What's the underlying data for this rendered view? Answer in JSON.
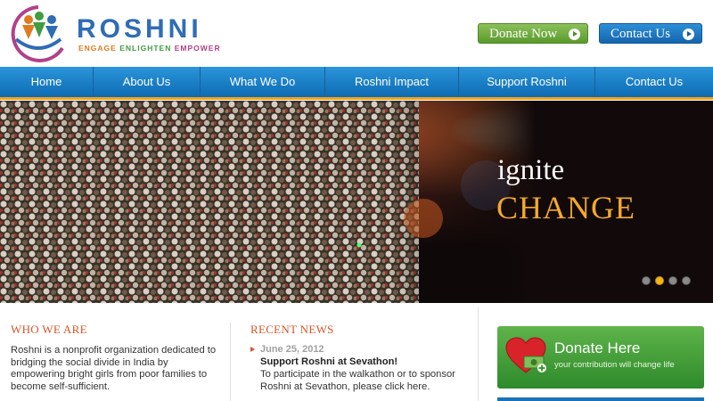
{
  "brand": {
    "name": "ROSHNI",
    "tagline": [
      "ENGAGE",
      "ENLIGHTEN",
      "EMPOWER"
    ]
  },
  "header_buttons": {
    "donate": "Donate Now",
    "contact": "Contact Us"
  },
  "nav": {
    "items": [
      {
        "label": "Home"
      },
      {
        "label": "About Us"
      },
      {
        "label": "What We Do"
      },
      {
        "label": "Roshni Impact"
      },
      {
        "label": "Support Roshni"
      },
      {
        "label": "Contact Us"
      }
    ]
  },
  "hero": {
    "line1": "ignite",
    "line2": "CHANGE",
    "slides": 4,
    "active_slide": 2
  },
  "who": {
    "title": "WHO WE ARE",
    "text": "Roshni is a nonprofit organization dedicated to bridging the social divide in India by empowering bright girls from poor families to become self-sufficient."
  },
  "news": {
    "title": "RECENT NEWS",
    "items": [
      {
        "date": "June 25, 2012",
        "headline": "Support Roshni at Sevathon!",
        "body": "To participate in the walkathon or to sponsor Roshni at Sevathon, please click here."
      }
    ]
  },
  "donate_box": {
    "title": "Donate Here",
    "subtitle": "your contribution will change life"
  },
  "colors": {
    "nav_blue": "#1a7cc6",
    "nav_underline": "#f2a31c",
    "section_title": "#d5562a",
    "hero_accent": "#f4a92a",
    "donate_green": "#4fa53d"
  }
}
